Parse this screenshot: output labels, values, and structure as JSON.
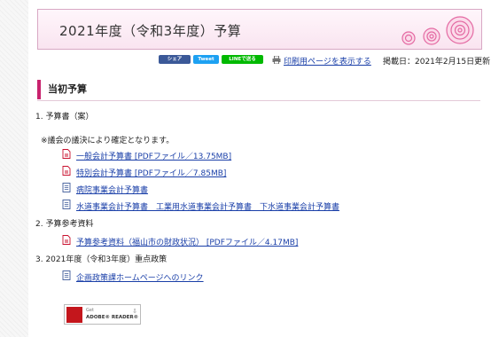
{
  "page": {
    "title": "2021年度（令和3年度）予算"
  },
  "share": {
    "facebook_label": "シェア",
    "twitter_label": "Tweet",
    "line_label": "LINEで送る",
    "print_link": "印刷用ページを表示する",
    "published": "掲載日：2021年2月15日更新"
  },
  "section": {
    "heading": "当初予算",
    "item1": "1. 予算書（案）",
    "note": "※議会の議決により確定となります。",
    "item1_links": [
      "一般会計予算書 [PDFファイル／13.75MB]",
      "特別会計予算書 [PDFファイル／7.85MB]",
      "病院事業会計予算書",
      "水道事業会計予算書　工業用水道事業会計予算書　下水道事業会計予算書"
    ],
    "item2": "2. 予算参考資料",
    "item2_links": [
      "予算参考資料（福山市の財政状況） [PDFファイル／4.17MB]"
    ],
    "item3": "3. 2021年度（令和3年度）重点政策",
    "item3_links": [
      "企画政策課ホームページへのリンク"
    ]
  },
  "reader": {
    "get_text": "Get",
    "brand_text": "ADOBE® READER®"
  },
  "icons": {
    "pdf": "pdf-icon",
    "page": "page-icon",
    "printer": "printer-icon",
    "roses": "rose-decoration"
  }
}
